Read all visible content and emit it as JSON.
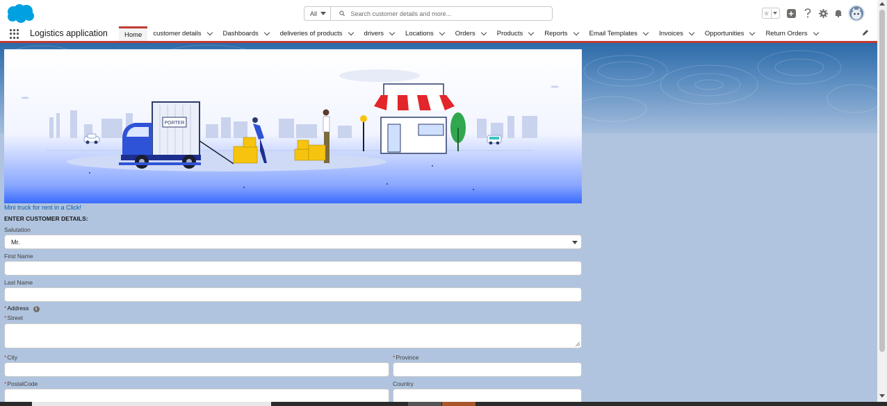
{
  "header": {
    "search_scope": "All",
    "search_placeholder": "Search customer details and more...",
    "icons": [
      "salesforce-cloud-logo",
      "search-icon",
      "favorites-star-icon",
      "add-icon",
      "help-icon",
      "setup-gear-icon",
      "notifications-bell-icon",
      "user-avatar"
    ]
  },
  "nav": {
    "app_name": "Logistics application",
    "tabs": [
      {
        "label": "Home",
        "has_menu": false
      },
      {
        "label": "customer details",
        "has_menu": true
      },
      {
        "label": "Dashboards",
        "has_menu": true
      },
      {
        "label": "deliveries of products",
        "has_menu": true
      },
      {
        "label": "drivers",
        "has_menu": true
      },
      {
        "label": "Locations",
        "has_menu": true
      },
      {
        "label": "Orders",
        "has_menu": true
      },
      {
        "label": "Products",
        "has_menu": true
      },
      {
        "label": "Reports",
        "has_menu": true
      },
      {
        "label": "Email Templates",
        "has_menu": true
      },
      {
        "label": "Invoices",
        "has_menu": true
      },
      {
        "label": "Opportunities",
        "has_menu": true
      },
      {
        "label": "Return Orders",
        "has_menu": true
      }
    ]
  },
  "banner": {
    "truck_text": "PORTER"
  },
  "content": {
    "link_text": "Mini truck for rent in a Click!",
    "section_title": "ENTER CUSTOMER DETAILS:"
  },
  "form": {
    "salutation_label": "Salutation",
    "salutation_value": "Mr.",
    "first_name_label": "First Name",
    "first_name_value": "",
    "last_name_label": "Last Name",
    "last_name_value": "",
    "address_label": "Address",
    "required_marker": "*",
    "street_label": "Street",
    "street_value": "",
    "city_label": "City",
    "city_value": "",
    "province_label": "Province",
    "province_value": "",
    "postal_code_label": "PostalCode",
    "postal_code_value": "",
    "country_label": "Country",
    "country_value": ""
  },
  "colors": {
    "brand_blue": "#0b5cab",
    "active_tab_accent": "#c23934",
    "page_background": "#b0c4df"
  }
}
